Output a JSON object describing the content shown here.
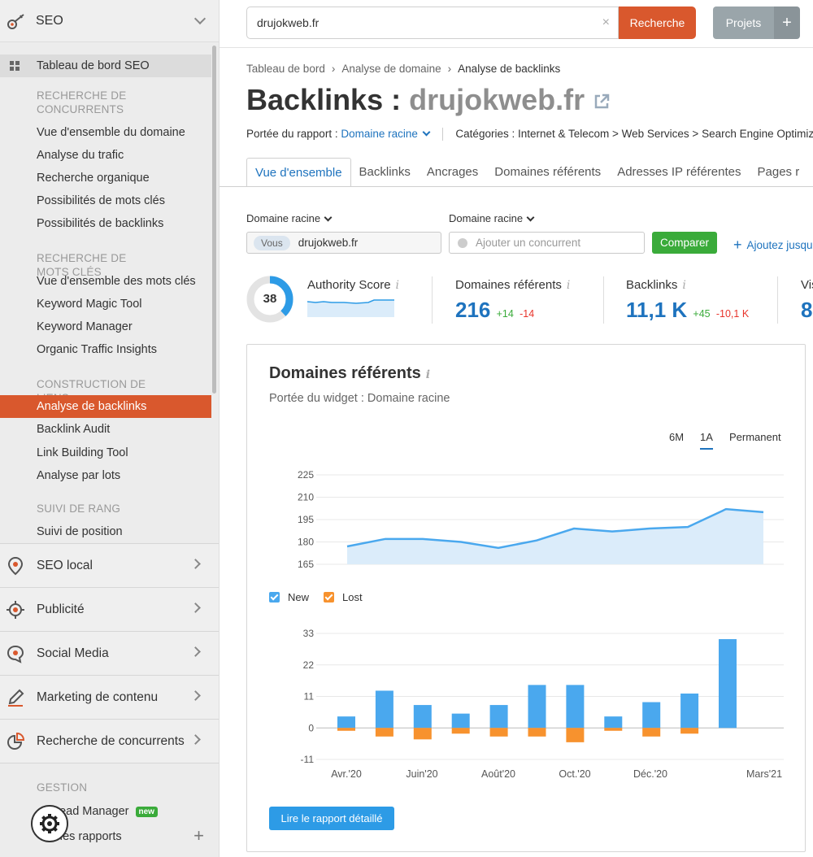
{
  "sidebar": {
    "header": "SEO",
    "top_item": "Tableau de bord SEO",
    "sections": [
      {
        "title": "RECHERCHE DE CONCURRENTS",
        "items": [
          "Vue d'ensemble du domaine",
          "Analyse du trafic",
          "Recherche organique",
          "Possibilités de mots clés",
          "Possibilités de backlinks"
        ]
      },
      {
        "title": "RECHERCHE DE MOTS CLÉS",
        "items": [
          "Vue d'ensemble des mots clés",
          "Keyword Magic Tool",
          "Keyword Manager",
          "Organic Traffic Insights"
        ]
      },
      {
        "title": "CONSTRUCTION DE LIENS",
        "items": [
          "Analyse de backlinks",
          "Backlink Audit",
          "Link Building Tool",
          "Analyse par lots"
        ]
      },
      {
        "title": "SUIVI DE RANG",
        "items": [
          "Suivi de position"
        ]
      }
    ],
    "groups": [
      "SEO local",
      "Publicité",
      "Social Media",
      "Marketing de contenu",
      "Recherche de concurrents"
    ],
    "gestion_title": "GESTION",
    "gestion_items": [
      "Lead Manager",
      "Mes rapports"
    ],
    "new_badge": "new"
  },
  "topbar": {
    "search_value": "drujokweb.fr",
    "search_btn": "Recherche",
    "projects_btn": "Projets",
    "plus": "+"
  },
  "breadcrumb": [
    "Tableau de bord",
    "Analyse de domaine",
    "Analyse de backlinks"
  ],
  "title_prefix": "Backlinks :",
  "title_domain": "drujokweb.fr",
  "scope": {
    "label": "Portée du rapport :",
    "value": "Domaine racine",
    "categories": "Catégories : Internet & Telecom > Web Services > Search Engine Optimizatio"
  },
  "tabs": [
    "Vue d'ensemble",
    "Backlinks",
    "Ancrages",
    "Domaines référents",
    "Adresses IP référentes",
    "Pages r"
  ],
  "compare": {
    "label1": "Domaine racine",
    "label2": "Domaine racine",
    "you": "Vous",
    "domain": "drujokweb.fr",
    "placeholder": "Ajouter un concurrent",
    "compare_btn": "Comparer",
    "add_more": "Ajoutez jusqu"
  },
  "metrics": {
    "authority_label": "Authority Score",
    "authority_value": "38",
    "authority_fraction": 0.38,
    "ref_label": "Domaines référents",
    "ref_value": "216",
    "ref_plus": "+14",
    "ref_minus": "-14",
    "bl_label": "Backlinks",
    "bl_value": "11,1 K",
    "bl_plus": "+45",
    "bl_minus": "-10,1 K",
    "vis_label": "Vis",
    "vis_value": "8"
  },
  "widget": {
    "title": "Domaines référents",
    "subtitle": "Portée du widget : Domaine racine",
    "ranges": [
      "6M",
      "1A",
      "Permanent"
    ],
    "active_range": "1A",
    "legend_new": "New",
    "legend_lost": "Lost",
    "report_btn": "Lire le rapport détaillé"
  },
  "colors": {
    "accent": "#d9582d",
    "blue": "#1e73be",
    "new": "#4aa8ee",
    "lost": "#f7922e",
    "green": "#3aab3a"
  },
  "chart_data": [
    {
      "type": "area",
      "title": "Domaines référents",
      "y_ticks": [
        165,
        180,
        195,
        210,
        225
      ],
      "ylim": [
        165,
        225
      ],
      "values": [
        177,
        182,
        182,
        180,
        176,
        181,
        189,
        187,
        189,
        190,
        202,
        200
      ]
    },
    {
      "type": "bar",
      "x_ticks": [
        "Avr.'20",
        "Juin'20",
        "Août'20",
        "Oct.'20",
        "Déc.'20",
        "Mars'21"
      ],
      "y_ticks": [
        -11,
        0,
        11,
        22,
        33
      ],
      "ylim": [
        -11,
        33
      ],
      "series": [
        {
          "name": "New",
          "values": [
            4,
            13,
            8,
            5,
            8,
            15,
            15,
            4,
            9,
            12,
            31
          ]
        },
        {
          "name": "Lost",
          "values": [
            -1,
            -3,
            -4,
            -2,
            -3,
            -3,
            -5,
            -1,
            -3,
            -2,
            0
          ]
        }
      ]
    }
  ]
}
